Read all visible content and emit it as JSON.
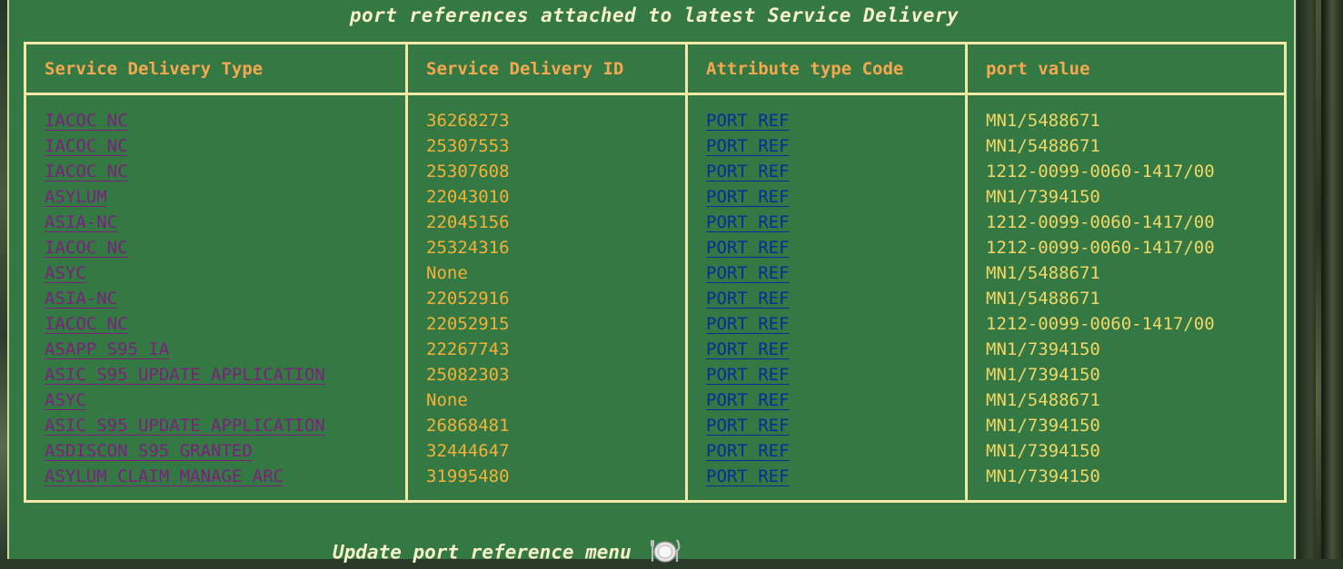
{
  "caption": "port references attached to latest Service Delivery",
  "table": {
    "headers": [
      "Service Delivery Type",
      "Service Delivery ID",
      "Attribute type Code",
      "port value"
    ],
    "rows": [
      {
        "type": "IACOC_NC",
        "id": "36268273",
        "attr": "PORT_REF",
        "port": "MN1/5488671"
      },
      {
        "type": "IACOC_NC",
        "id": "25307553",
        "attr": "PORT_REF",
        "port": "MN1/5488671"
      },
      {
        "type": "IACOC_NC",
        "id": "25307608",
        "attr": "PORT_REF",
        "port": "1212-0099-0060-1417/00"
      },
      {
        "type": "ASYLUM",
        "id": "22043010",
        "attr": "PORT_REF",
        "port": "MN1/7394150"
      },
      {
        "type": "ASIA-NC",
        "id": "22045156",
        "attr": "PORT_REF",
        "port": "1212-0099-0060-1417/00"
      },
      {
        "type": "IACOC_NC",
        "id": "25324316",
        "attr": "PORT_REF",
        "port": "1212-0099-0060-1417/00"
      },
      {
        "type": "ASYC",
        "id": "None",
        "attr": "PORT_REF",
        "port": "MN1/5488671"
      },
      {
        "type": "ASIA-NC",
        "id": "22052916",
        "attr": "PORT_REF",
        "port": "MN1/5488671"
      },
      {
        "type": "IACOC_NC",
        "id": "22052915",
        "attr": "PORT_REF",
        "port": "1212-0099-0060-1417/00"
      },
      {
        "type": "ASAPP_S95_IA",
        "id": "22267743",
        "attr": "PORT_REF",
        "port": "MN1/7394150"
      },
      {
        "type": "ASIC_S95_UPDATE_APPLICATION",
        "id": "25082303",
        "attr": "PORT_REF",
        "port": "MN1/7394150"
      },
      {
        "type": "ASYC",
        "id": "None",
        "attr": "PORT_REF",
        "port": "MN1/5488671"
      },
      {
        "type": "ASIC_S95_UPDATE_APPLICATION",
        "id": "26868481",
        "attr": "PORT_REF",
        "port": "MN1/7394150"
      },
      {
        "type": "ASDISCON_S95_GRANTED",
        "id": "32444647",
        "attr": "PORT_REF",
        "port": "MN1/7394150"
      },
      {
        "type": "ASYLUM_CLAIM_MANAGE_ARC",
        "id": "31995480",
        "attr": "PORT_REF",
        "port": "MN1/7394150"
      }
    ]
  },
  "footer": {
    "update_link": "Update port reference menu",
    "update_icon": "plate-fork-knife-icon"
  },
  "colors": {
    "panel": "#347843",
    "border": "#f1e9a8",
    "header_text": "#f5a84f",
    "type_link": "#7d1f7f",
    "id_text": "#f2b23a",
    "attr_link": "#082c9a",
    "port_text": "#f0d766"
  }
}
